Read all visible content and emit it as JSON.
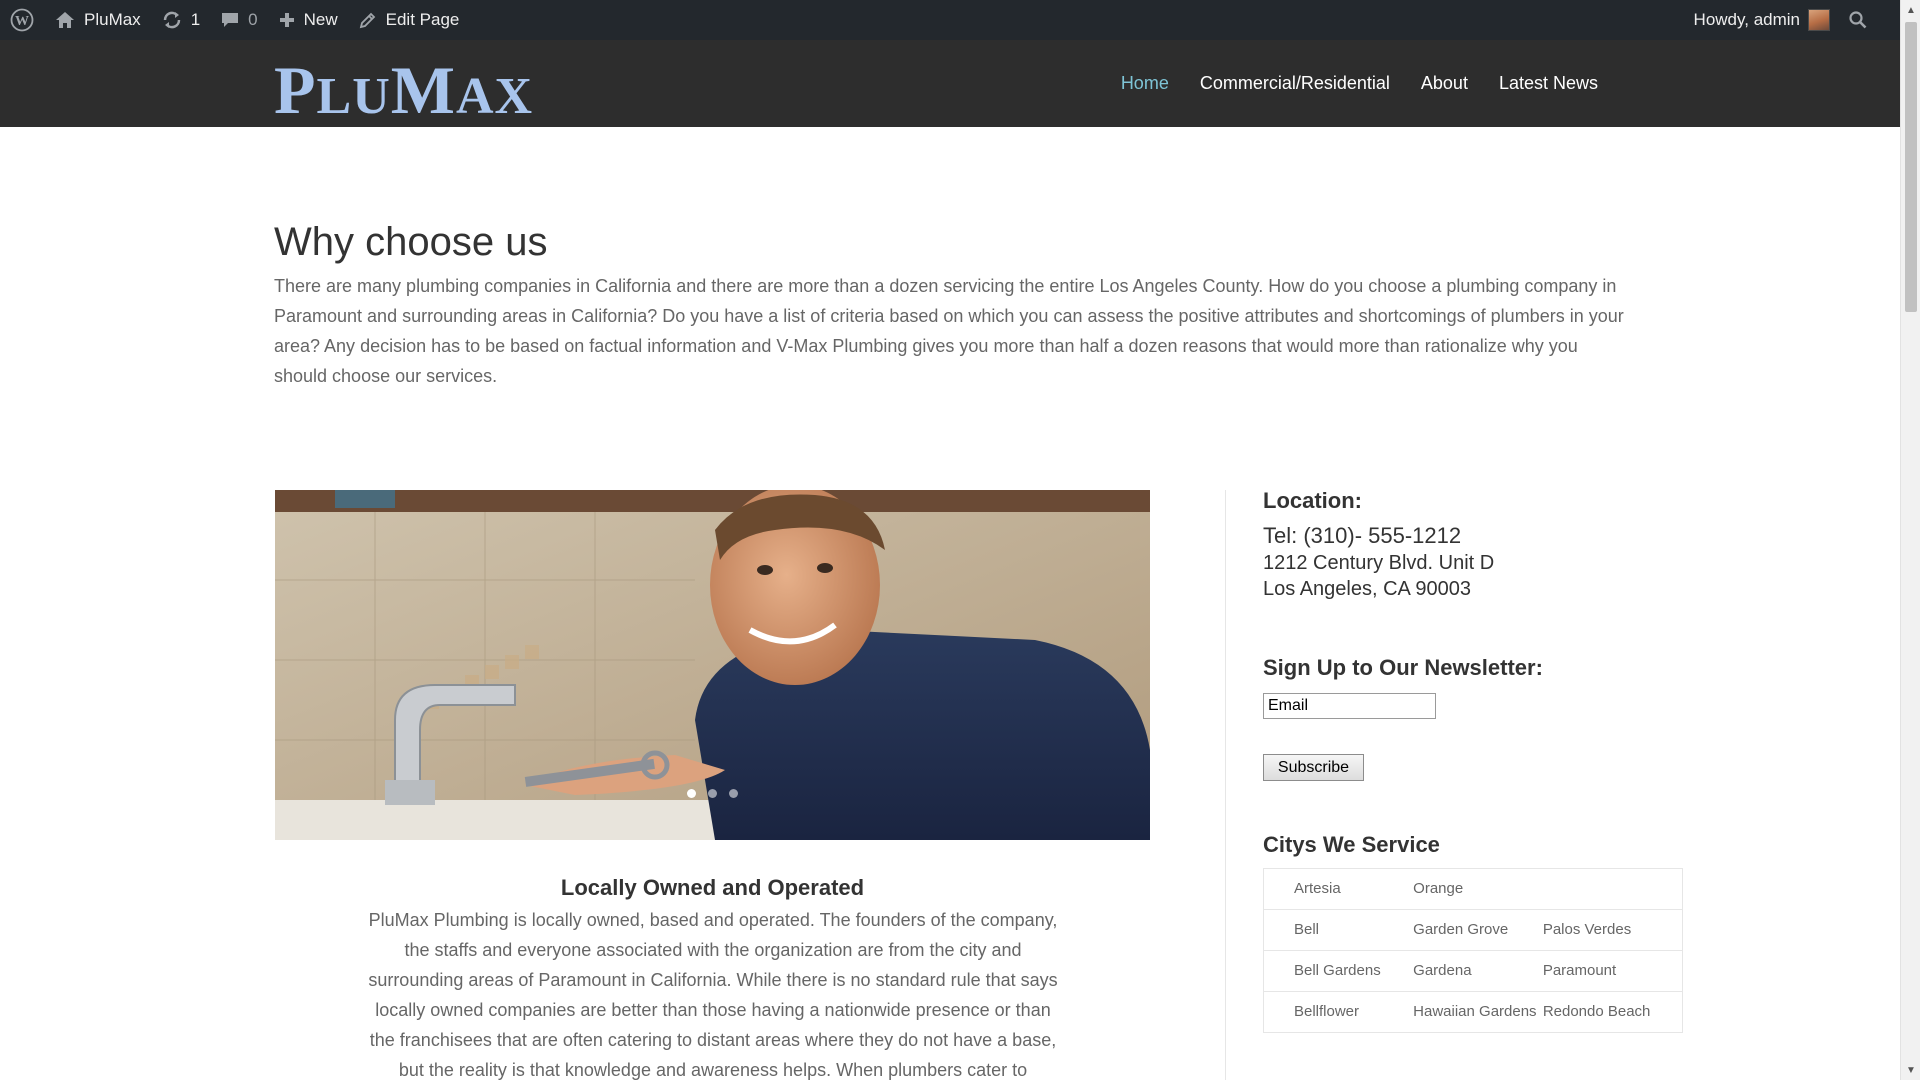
{
  "admin_bar": {
    "site_name": "PluMax",
    "updates_count": "1",
    "comments_count": "0",
    "new_label": "New",
    "edit_label": "Edit Page",
    "greeting": "Howdy, admin",
    "icons": [
      "wordpress-logo-icon",
      "home-icon",
      "refresh-icon",
      "comment-icon",
      "plus-icon",
      "pencil-icon",
      "search-icon"
    ]
  },
  "header": {
    "logo_parts": [
      "P",
      "LU",
      "M",
      "AX"
    ],
    "logo_color": "#a8c4ec",
    "nav": [
      {
        "label": "Home",
        "active": true
      },
      {
        "label": "Commercial/Residential",
        "active": false
      },
      {
        "label": "About",
        "active": false
      },
      {
        "label": "Latest News",
        "active": false
      }
    ],
    "active_color": "#7ec4d6",
    "background": "#2d2d2d"
  },
  "why": {
    "title": "Why choose us",
    "text": "There are many plumbing companies in California and there are more than a dozen servicing the entire Los Angeles County. How do you choose a plumbing company in Paramount and surrounding areas in California? Do you have a list of criteria based on which you can assess the positive attributes and shortcomings of plumbers in your area? Any decision has to be based on factual information and V-Max Plumbing gives you more than half a dozen reasons that would more than rationalize why you should choose our services."
  },
  "slider": {
    "slide_count": 3,
    "active_slide": 1
  },
  "locally": {
    "title": "Locally Owned and Operated",
    "text": "PluMax Plumbing is locally owned, based and operated. The founders of the company, the staffs and everyone associated with the organization are from the city and surrounding areas of Paramount in California. While there is no standard rule that says locally owned companies are better than those having a nationwide presence or than the franchisees that are often catering to distant areas where they do not have a base, but the reality is that knowledge and awareness helps. When plumbers cater to"
  },
  "sidebar": {
    "location_title": "Location:",
    "tel": "Tel: (310)- 555-1212",
    "address_line1": "1212 Century Blvd. Unit D",
    "address_line2": "Los Angeles, CA 90003",
    "newsletter_title": "Sign Up to Our Newsletter:",
    "email_value": "Email",
    "subscribe_label": "Subscribe",
    "cities_title": "Citys We Service",
    "cities": [
      [
        "Artesia",
        "Orange",
        ""
      ],
      [
        "Bell",
        "Garden Grove",
        "Palos Verdes"
      ],
      [
        "Bell Gardens",
        "Gardena",
        "Paramount"
      ],
      [
        "Bellflower",
        "Hawaiian Gardens",
        "Redondo Beach"
      ]
    ]
  }
}
